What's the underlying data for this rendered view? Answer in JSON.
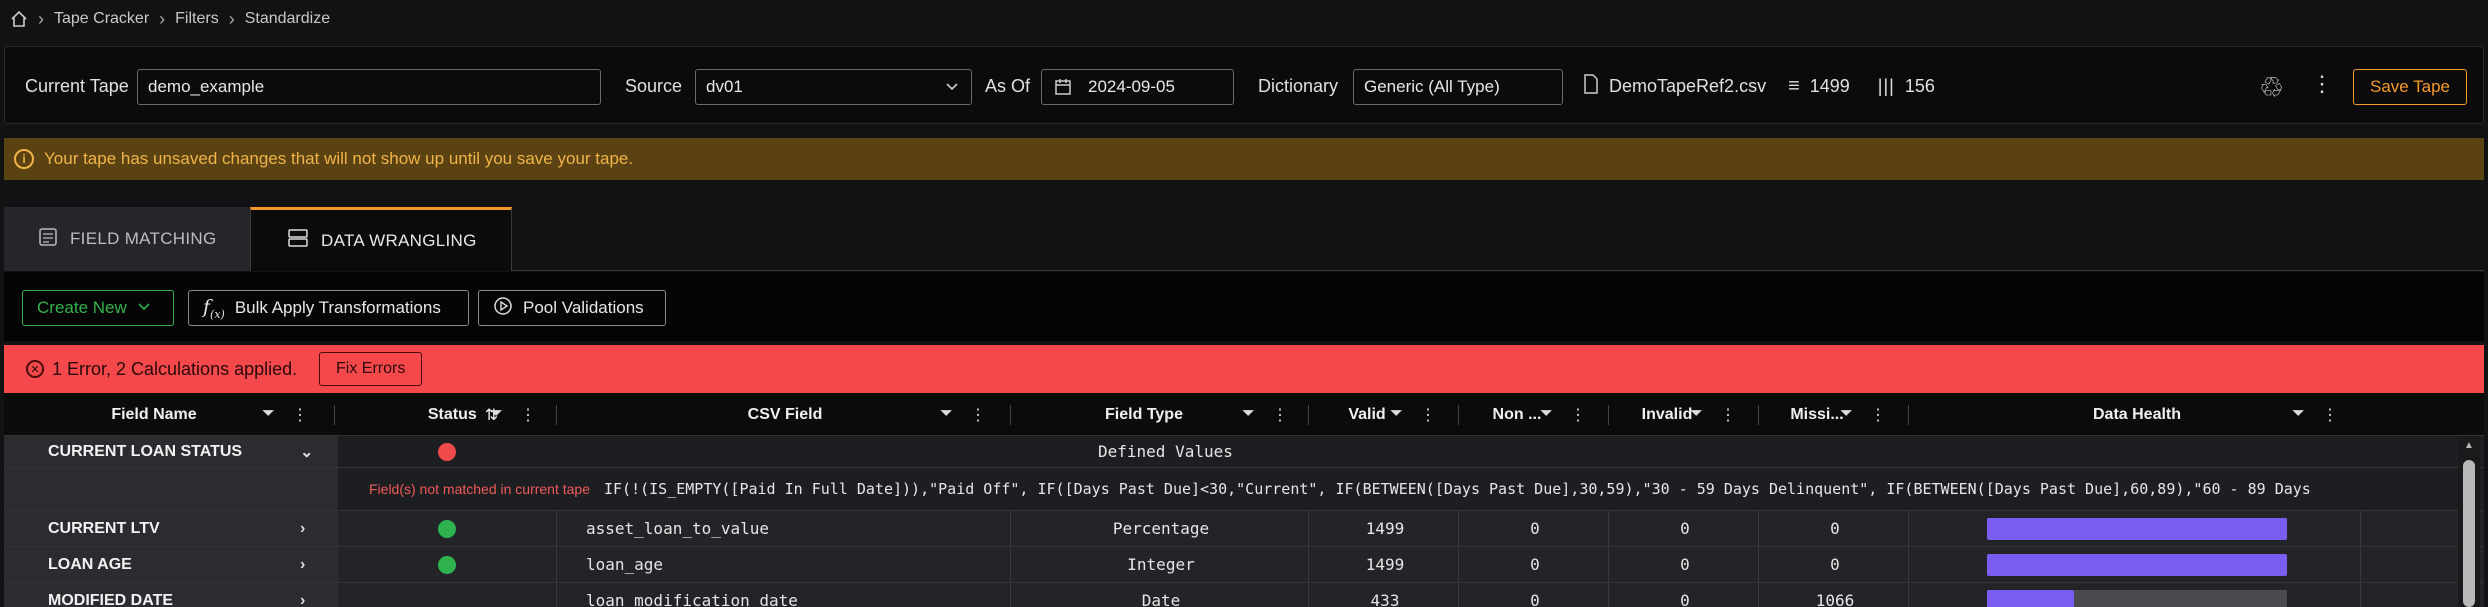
{
  "breadcrumb": {
    "home_icon": "home-icon",
    "items": [
      "Tape Cracker",
      "Filters",
      "Standardize"
    ]
  },
  "header": {
    "current_tape_label": "Current Tape",
    "current_tape_value": "demo_example",
    "source_label": "Source",
    "source_value": "dv01",
    "asof_label": "As Of",
    "asof_value": "2024-09-05",
    "dictionary_label": "Dictionary",
    "dictionary_value": "Generic (All Type)",
    "file_name": "DemoTapeRef2.csv",
    "rows": "1499",
    "cols": "156",
    "save_label": "Save Tape"
  },
  "warning": {
    "text": "Your tape has unsaved changes that will not show up until you save your tape."
  },
  "tabs": [
    {
      "label": "FIELD MATCHING",
      "active": false
    },
    {
      "label": "DATA WRANGLING",
      "active": true
    }
  ],
  "toolbar": {
    "create_new": "Create New",
    "bulk_apply": "Bulk Apply Transformations",
    "pool_validations": "Pool Validations"
  },
  "error_banner": {
    "text": "1 Error, 2 Calculations applied.",
    "fix_label": "Fix Errors"
  },
  "table": {
    "columns": [
      "Field Name",
      "Status",
      "CSV Field",
      "Field Type",
      "Valid",
      "Non ...",
      "Invalid",
      "Missi...",
      "Data Health"
    ],
    "expanded": {
      "field": "CURRENT LOAN STATUS",
      "status_color": "#f04b4b",
      "defined": "Defined Values",
      "warning": "Field(s) not matched in current tape",
      "formula": "IF(!(IS_EMPTY([Paid In Full Date])),\"Paid Off\", IF([Days Past Due]<30,\"Current\", IF(BETWEEN([Days Past Due],30,59),\"30 - 59 Days Delinquent\", IF(BETWEEN([Days Past Due],60,89),\"60 - 89 Days"
    },
    "rows": [
      {
        "field": "CURRENT LTV",
        "status_color": "#2fb34f",
        "csv": "asset_loan_to_value",
        "type": "Percentage",
        "valid": "1499",
        "non": "0",
        "invalid": "0",
        "missing": "0",
        "health": 1.0
      },
      {
        "field": "LOAN AGE",
        "status_color": "#2fb34f",
        "csv": "loan_age",
        "type": "Integer",
        "valid": "1499",
        "non": "0",
        "invalid": "0",
        "missing": "0",
        "health": 1.0
      },
      {
        "field": "MODIFIED DATE",
        "status_color": "",
        "csv": "loan_modification_date",
        "type": "Date",
        "valid": "433",
        "non": "0",
        "invalid": "0",
        "missing": "1066",
        "health": 0.289
      }
    ]
  },
  "colors": {
    "accent": "#f39a2b",
    "error": "#f4484b",
    "ok": "#2fb34f",
    "health": "#7b5cf0"
  }
}
